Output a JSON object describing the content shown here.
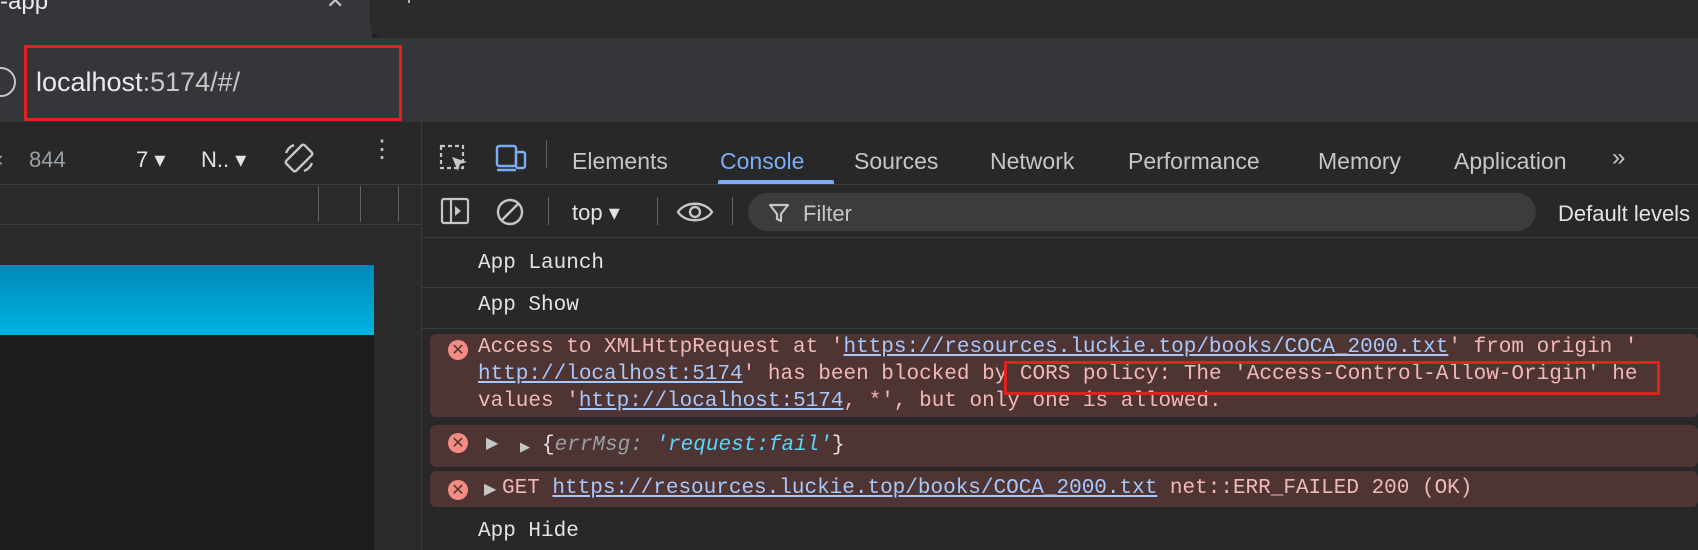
{
  "browser": {
    "tab_title": "-app",
    "tab_close": "✕",
    "new_tab": "+",
    "url_host": "localhost",
    "url_rest": ":5174/#/"
  },
  "device_toolbar": {
    "close": "‹",
    "size": "844",
    "zoom": "7 ▾",
    "network": "N.. ▾",
    "more": "⋮"
  },
  "devtools": {
    "tabs": [
      "Elements",
      "Console",
      "Sources",
      "Network",
      "Performance",
      "Memory",
      "Application"
    ],
    "active_tab": "Console",
    "more_tabs": "»",
    "console": {
      "context": "top ▾",
      "filter_placeholder": "Filter",
      "levels": "Default levels"
    }
  },
  "messages": {
    "launch": "App Launch",
    "show": "App Show",
    "cors": {
      "l1_pre": "Access to XMLHttpRequest at '",
      "l1_link": "https://resources.luckie.top/books/COCA_2000.txt",
      "l1_post": "' from origin '",
      "l2_link": "http://localhost:5174",
      "l2_mid": "' has been blocked ",
      "l2_boxed": "by CORS policy: The 'Access-Control-Allow-Origin'",
      "l2_post": " he",
      "l3_pre": "values '",
      "l3_link": "http://localhost:5174",
      "l3_post": ", *', but only one is allowed."
    },
    "obj": {
      "open": "{",
      "key": "errMsg",
      "colon": ": ",
      "value": "'request:fail'",
      "close": "}"
    },
    "get": {
      "method": "GET ",
      "link": "https://resources.luckie.top/books/COCA_2000.txt",
      "status": " net::ERR_FAILED 200 (OK)"
    },
    "hide": "App Hide"
  },
  "colors": {
    "accent": "#7cacf8",
    "error_bg": "#4e3534",
    "highlight_box": "#e0221e",
    "app_header": "#00a3d6"
  }
}
